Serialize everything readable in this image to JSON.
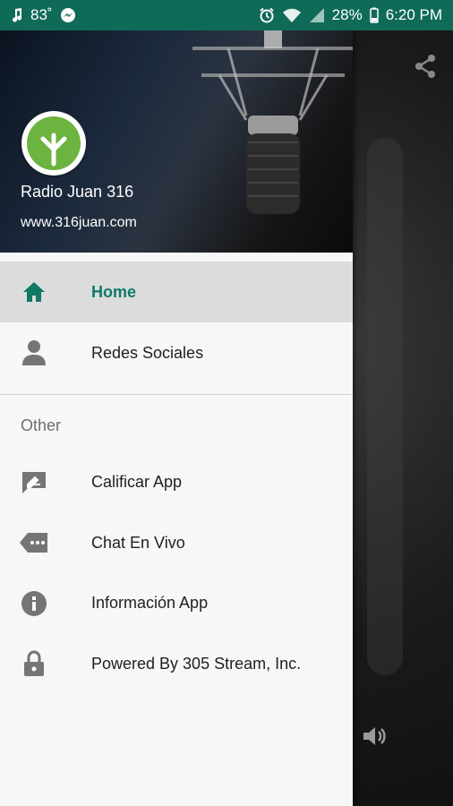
{
  "status_bar": {
    "temperature": "83",
    "battery": "28%",
    "time": "6:20 PM",
    "icons_left": [
      "music-note-icon",
      "messenger-icon"
    ],
    "icons_right": [
      "alarm-icon",
      "wifi-icon",
      "signal-icon",
      "battery-icon"
    ]
  },
  "drawer": {
    "header": {
      "station_name": "Radio Juan 316",
      "url": "www.316juan.com"
    },
    "items": [
      {
        "label": "Home",
        "icon": "home-icon",
        "active": true
      },
      {
        "label": "Redes Sociales",
        "icon": "person-icon",
        "active": false
      }
    ],
    "section_title": "Other",
    "other_items": [
      {
        "label": "Calificar App",
        "icon": "rate-icon"
      },
      {
        "label": "Chat En Vivo",
        "icon": "chat-icon"
      },
      {
        "label": "Información App",
        "icon": "info-icon"
      },
      {
        "label": "Powered By 305 Stream, Inc.",
        "icon": "lock-icon"
      }
    ]
  },
  "colors": {
    "status_bar": "#0f6b58",
    "accent": "#0f7a66",
    "logo_green": "#6cb33f"
  }
}
